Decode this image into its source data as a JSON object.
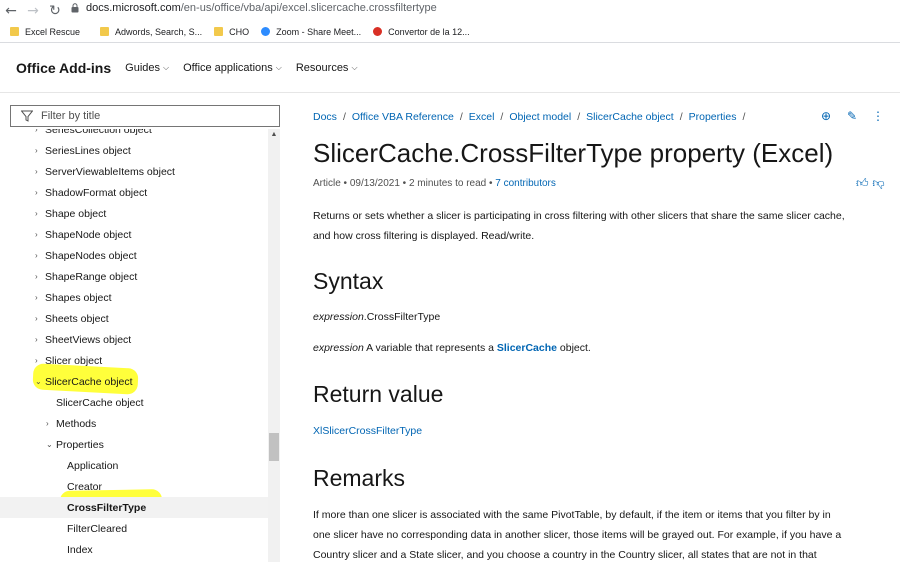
{
  "browser": {
    "url_host": "docs.microsoft.com",
    "url_path": "/en-us/office/vba/api/excel.slicercache.crossfiltertype",
    "bookmarks": [
      {
        "label": "Excel Rescue",
        "color": "#f2c94c"
      },
      {
        "label": "Adwords, Search, S...",
        "color": "#f2c94c"
      },
      {
        "label": "CHO",
        "color": "#f2c94c"
      },
      {
        "label": "Zoom - Share Meet...",
        "color": "#2d8cff"
      },
      {
        "label": "Convertor de la 12...",
        "color": "#d93025"
      }
    ]
  },
  "header": {
    "brand": "Office Add-ins",
    "nav": [
      "Guides",
      "Office applications",
      "Resources"
    ]
  },
  "sidebar": {
    "filter_placeholder": "Filter by title",
    "items": [
      {
        "label": "SeriesCollection object",
        "indent": 0,
        "expander": true
      },
      {
        "label": "SeriesLines object",
        "indent": 0,
        "expander": true
      },
      {
        "label": "ServerViewableItems object",
        "indent": 0,
        "expander": true
      },
      {
        "label": "ShadowFormat object",
        "indent": 0,
        "expander": true
      },
      {
        "label": "Shape object",
        "indent": 0,
        "expander": true
      },
      {
        "label": "ShapeNode object",
        "indent": 0,
        "expander": true
      },
      {
        "label": "ShapeNodes object",
        "indent": 0,
        "expander": true
      },
      {
        "label": "ShapeRange object",
        "indent": 0,
        "expander": true
      },
      {
        "label": "Shapes object",
        "indent": 0,
        "expander": true
      },
      {
        "label": "Sheets object",
        "indent": 0,
        "expander": true
      },
      {
        "label": "SheetViews object",
        "indent": 0,
        "expander": true
      },
      {
        "label": "Slicer object",
        "indent": 0,
        "expander": true
      },
      {
        "label": "SlicerCache object",
        "indent": 0,
        "expander": true,
        "expanded": true
      },
      {
        "label": "SlicerCache object",
        "indent": 1,
        "expander": false
      },
      {
        "label": "Methods",
        "indent": 1,
        "expander": true
      },
      {
        "label": "Properties",
        "indent": 1,
        "expander": true,
        "expanded": true
      },
      {
        "label": "Application",
        "indent": 2,
        "expander": false
      },
      {
        "label": "Creator",
        "indent": 2,
        "expander": false
      },
      {
        "label": "CrossFilterType",
        "indent": 2,
        "expander": false,
        "selected": true
      },
      {
        "label": "FilterCleared",
        "indent": 2,
        "expander": false
      },
      {
        "label": "Index",
        "indent": 2,
        "expander": false
      }
    ]
  },
  "main": {
    "breadcrumbs": [
      "Docs",
      "Office VBA Reference",
      "Excel",
      "Object model",
      "SlicerCache object",
      "Properties"
    ],
    "title": "SlicerCache.CrossFilterType property (Excel)",
    "meta_prefix": "Article • 09/13/2021 • 2 minutes to read •",
    "contributors": "7 contributors",
    "intro_line1": "Returns or sets whether a slicer is participating in cross filtering with other slicers that share the same slicer cache,",
    "intro_line2": "and how cross filtering is displayed. Read/write.",
    "syntax_heading": "Syntax",
    "syntax_expr": "expression",
    "syntax_prop": ".CrossFilterType",
    "param_expr": "expression",
    "param_text": " A variable that represents a ",
    "param_link": "SlicerCache",
    "param_end": " object.",
    "return_heading": "Return value",
    "return_link": "XlSlicerCrossFilterType",
    "remarks_heading": "Remarks",
    "remarks_line1": "If more than one slicer is associated with the same PivotTable, by default, if the item or items that you filter by in",
    "remarks_line2": "one slicer have no corresponding data in another slicer, those items will be grayed out. For example, if you have a",
    "remarks_line3": "Country slicer and a State slicer, and you choose a country in the Country slicer, all states that are not in that"
  },
  "colors": {
    "link": "#0065b3",
    "highlight": "#ffff3b",
    "selected_row": "#f2f2f2"
  }
}
